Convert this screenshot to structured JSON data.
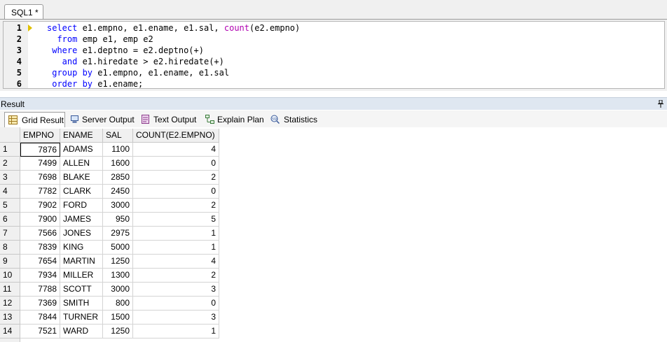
{
  "editor": {
    "tab_label": "SQL1 *",
    "lines": [
      {
        "num": "1",
        "parts": [
          {
            "t": "select",
            "c": "kw"
          },
          {
            "t": " e1.empno, e1.ename, e1.sal, ",
            "c": ""
          },
          {
            "t": "count",
            "c": "fn"
          },
          {
            "t": "(e2.empno)",
            "c": ""
          }
        ]
      },
      {
        "num": "2",
        "parts": [
          {
            "t": "  from",
            "c": "kw"
          },
          {
            "t": " emp e1, emp e2",
            "c": ""
          }
        ]
      },
      {
        "num": "3",
        "parts": [
          {
            "t": " where",
            "c": "kw"
          },
          {
            "t": " e1.deptno = e2.deptno(+)",
            "c": ""
          }
        ]
      },
      {
        "num": "4",
        "parts": [
          {
            "t": "   and",
            "c": "kw"
          },
          {
            "t": " e1.hiredate > e2.hiredate(+)",
            "c": ""
          }
        ]
      },
      {
        "num": "5",
        "parts": [
          {
            "t": " group by",
            "c": "kw"
          },
          {
            "t": " e1.empno, e1.ename, e1.sal",
            "c": ""
          }
        ]
      },
      {
        "num": "6",
        "parts": [
          {
            "t": " order by",
            "c": "kw"
          },
          {
            "t": " e1.ename;",
            "c": ""
          }
        ]
      }
    ]
  },
  "result_panel": {
    "title": "Result",
    "tabs": [
      {
        "label": "Grid Result",
        "icon": "grid-icon",
        "active": true
      },
      {
        "label": "Server Output",
        "icon": "server-output-icon",
        "active": false
      },
      {
        "label": "Text Output",
        "icon": "text-output-icon",
        "active": false
      },
      {
        "label": "Explain Plan",
        "icon": "explain-plan-icon",
        "active": false
      },
      {
        "label": "Statistics",
        "icon": "statistics-icon",
        "active": false
      }
    ]
  },
  "grid": {
    "columns": [
      "EMPNO",
      "ENAME",
      "SAL",
      "COUNT(E2.EMPNO)"
    ],
    "rows": [
      [
        "1",
        "7876",
        "ADAMS",
        "1100",
        "4"
      ],
      [
        "2",
        "7499",
        "ALLEN",
        "1600",
        "0"
      ],
      [
        "3",
        "7698",
        "BLAKE",
        "2850",
        "2"
      ],
      [
        "4",
        "7782",
        "CLARK",
        "2450",
        "0"
      ],
      [
        "5",
        "7902",
        "FORD",
        "3000",
        "2"
      ],
      [
        "6",
        "7900",
        "JAMES",
        "950",
        "5"
      ],
      [
        "7",
        "7566",
        "JONES",
        "2975",
        "1"
      ],
      [
        "8",
        "7839",
        "KING",
        "5000",
        "1"
      ],
      [
        "9",
        "7654",
        "MARTIN",
        "1250",
        "4"
      ],
      [
        "10",
        "7934",
        "MILLER",
        "1300",
        "2"
      ],
      [
        "11",
        "7788",
        "SCOTT",
        "3000",
        "3"
      ],
      [
        "12",
        "7369",
        "SMITH",
        "800",
        "0"
      ],
      [
        "13",
        "7844",
        "TURNER",
        "1500",
        "3"
      ],
      [
        "14",
        "7521",
        "WARD",
        "1250",
        "1"
      ]
    ]
  }
}
